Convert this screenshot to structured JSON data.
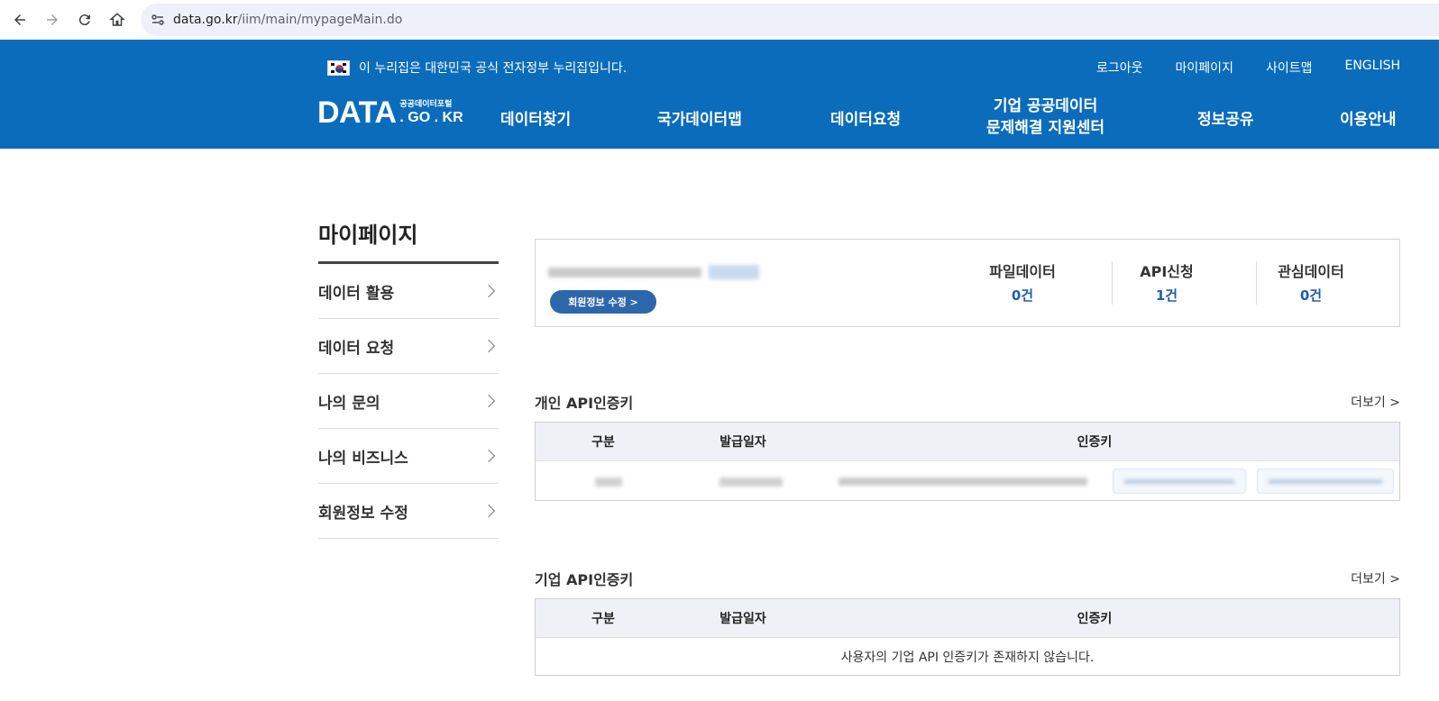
{
  "browser": {
    "url_host": "data.go.kr",
    "url_path": "/iim/main/mypageMain.do"
  },
  "header": {
    "gov_notice": "이 누리집은 대한민국 공식 전자정부 누리집입니다.",
    "util_links": [
      "로그아웃",
      "마이페이지",
      "사이트맵",
      "ENGLISH"
    ],
    "logo": {
      "main": "DATA",
      "sub": "공공데이터포털",
      "domain": ". GO . KR"
    },
    "nav": {
      "find": "데이터찾기",
      "map": "국가데이터맵",
      "request": "데이터요청",
      "corp_line1": "기업 공공데이터",
      "corp_line2": "문제해결 지원센터",
      "share": "정보공유",
      "guide": "이용안내"
    },
    "brand_color": "#0b6cbc"
  },
  "sidebar": {
    "title": "마이페이지",
    "items": [
      {
        "label": "데이터 활용"
      },
      {
        "label": "데이터 요청"
      },
      {
        "label": "나의 문의"
      },
      {
        "label": "나의 비즈니스"
      },
      {
        "label": "회원정보 수정"
      }
    ]
  },
  "summary": {
    "edit_button": "회원정보 수정 >",
    "stats": [
      {
        "label": "파일데이터",
        "value": "0건"
      },
      {
        "label": "API신청",
        "value": "1건"
      },
      {
        "label": "관심데이터",
        "value": "0건"
      }
    ]
  },
  "personal_api": {
    "title": "개인 API인증키",
    "more": "더보기 >",
    "columns": [
      "구분",
      "발급일자",
      "인증키"
    ]
  },
  "corp_api": {
    "title": "기업 API인증키",
    "more": "더보기 >",
    "columns": [
      "구분",
      "발급일자",
      "인증키"
    ],
    "empty_message": "사용자의 기업 API 인증키가 존재하지 않습니다."
  }
}
